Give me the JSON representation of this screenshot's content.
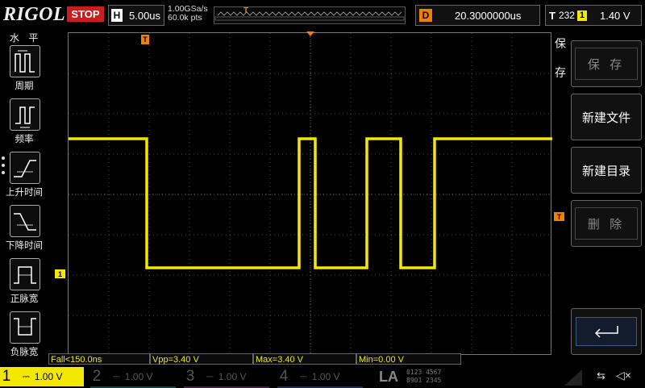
{
  "brand": "RIGOL",
  "run_state": "STOP",
  "horizontal": {
    "key": "H",
    "scale": "5.00us"
  },
  "acquisition": {
    "sample_rate": "1.00GSa/s",
    "memory_depth": "60.0k pts"
  },
  "delay": {
    "key": "D",
    "value": "20.3000000us"
  },
  "trigger": {
    "key": "T",
    "mode_code": "232",
    "source": "1",
    "level": "1.40 V"
  },
  "left_menu": {
    "title": "水 平",
    "items": [
      {
        "label": "周期",
        "icon": "period-icon"
      },
      {
        "label": "频率",
        "icon": "frequency-icon"
      },
      {
        "label": "上升时间",
        "icon": "rise-time-icon"
      },
      {
        "label": "下降时间",
        "icon": "fall-time-icon"
      },
      {
        "label": "正脉宽",
        "icon": "positive-width-icon"
      },
      {
        "label": "负脉宽",
        "icon": "negative-width-icon"
      }
    ]
  },
  "right_menu": {
    "tab": [
      "保",
      "存"
    ],
    "buttons": [
      {
        "label": "保 存",
        "enabled": false
      },
      {
        "label": "新建文件",
        "enabled": true
      },
      {
        "label": "新建目录",
        "enabled": true
      },
      {
        "label": "删 除",
        "enabled": false
      },
      {
        "label": "",
        "icon": "enter-icon",
        "enabled": true
      }
    ]
  },
  "markers": {
    "ch1": "1",
    "trigger_level": "T",
    "trigger_pos": "T"
  },
  "measurements": [
    {
      "label": "Fall<150.0ns"
    },
    {
      "label": "Vpp=3.40 V"
    },
    {
      "label": "Max=3.40 V"
    },
    {
      "label": "Min=0.00 V"
    }
  ],
  "channels": [
    {
      "num": "1",
      "scale": "1.00 V",
      "color": "#f5e800",
      "active": true
    },
    {
      "num": "2",
      "scale": "1.00 V",
      "color": "#00c8c8",
      "active": false
    },
    {
      "num": "3",
      "scale": "1.00 V",
      "color": "#d040d0",
      "active": false
    },
    {
      "num": "4",
      "scale": "1.00 V",
      "color": "#3080ff",
      "active": false
    }
  ],
  "la": {
    "label": "LA",
    "row1": "0123 4567",
    "row2": "8901 2345"
  },
  "colors": {
    "ch1": "#f5e800",
    "trigger": "#f08000",
    "stop": "#c81e1e"
  }
}
